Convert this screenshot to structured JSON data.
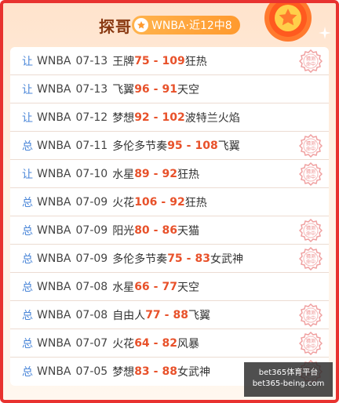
{
  "header": {
    "title": "探哥",
    "tag_label": "WNBA·近12中8"
  },
  "colors": {
    "border": "#e8322f",
    "score": "#e8512a",
    "kind": "#4a86d8",
    "tag": "#ff9a2e"
  },
  "icons": {
    "tag": "star-icon",
    "medal": "medal-star-icon",
    "stamp": "hit-stamp-icon",
    "sparkle": "sparkle-icon"
  },
  "rows": [
    {
      "kind": "让",
      "league": "WNBA",
      "date": "07-13",
      "home": "王牌",
      "home_score": "75",
      "sep": "-",
      "away_score": "109",
      "away": "狂热",
      "stamp": true
    },
    {
      "kind": "让",
      "league": "WNBA",
      "date": "07-13",
      "home": "飞翼",
      "home_score": "96",
      "sep": "-",
      "away_score": "91",
      "away": "天空",
      "stamp": false
    },
    {
      "kind": "让",
      "league": "WNBA",
      "date": "07-12",
      "home": "梦想",
      "home_score": "92",
      "sep": "-",
      "away_score": "102",
      "away": "波特兰火焰",
      "stamp": false
    },
    {
      "kind": "总",
      "league": "WNBA",
      "date": "07-11",
      "home": "多伦多节奏",
      "home_score": "95",
      "sep": "-",
      "away_score": "108",
      "away": "飞翼",
      "stamp": true
    },
    {
      "kind": "让",
      "league": "WNBA",
      "date": "07-10",
      "home": "水星",
      "home_score": "89",
      "sep": "-",
      "away_score": "92",
      "away": "狂热",
      "stamp": true
    },
    {
      "kind": "总",
      "league": "WNBA",
      "date": "07-09",
      "home": "火花",
      "home_score": "106",
      "sep": "-",
      "away_score": "92",
      "away": "狂热",
      "stamp": false
    },
    {
      "kind": "总",
      "league": "WNBA",
      "date": "07-09",
      "home": "阳光",
      "home_score": "80",
      "sep": "-",
      "away_score": "86",
      "away": "天猫",
      "stamp": true
    },
    {
      "kind": "总",
      "league": "WNBA",
      "date": "07-09",
      "home": "多伦多节奏",
      "home_score": "75",
      "sep": "-",
      "away_score": "83",
      "away": "女武神",
      "stamp": true
    },
    {
      "kind": "总",
      "league": "WNBA",
      "date": "07-08",
      "home": "水星",
      "home_score": "66",
      "sep": "-",
      "away_score": "77",
      "away": "天空",
      "stamp": false
    },
    {
      "kind": "总",
      "league": "WNBA",
      "date": "07-08",
      "home": "自由人",
      "home_score": "77",
      "sep": "-",
      "away_score": "88",
      "away": "飞翼",
      "stamp": true
    },
    {
      "kind": "总",
      "league": "WNBA",
      "date": "07-07",
      "home": "火花",
      "home_score": "64",
      "sep": "-",
      "away_score": "82",
      "away": "风暴",
      "stamp": true
    },
    {
      "kind": "总",
      "league": "WNBA",
      "date": "07-05",
      "home": "梦想",
      "home_score": "83",
      "sep": "-",
      "away_score": "88",
      "away": "女武神",
      "stamp": true
    }
  ],
  "stamp_text": "猜测命中",
  "watermark": {
    "line1": "bet365体育平台",
    "line2": "bet365-being.com"
  }
}
